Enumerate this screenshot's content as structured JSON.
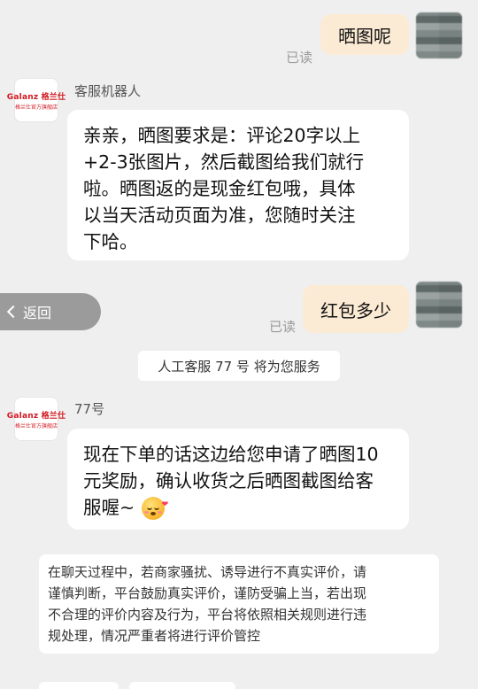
{
  "messages": {
    "user1": {
      "text": "晒图呢",
      "status": "已读"
    },
    "bot1": {
      "sender": "客服机器人",
      "lines": [
        "亲亲，晒图要求是：评论20字以上",
        "+2-3张图片，然后截图给我们就行",
        "啦。晒图返的是现金红包哦，具体",
        "以当天活动页面为准，您随时关注",
        "下哈。"
      ]
    },
    "user2": {
      "text": "红包多少",
      "status": "已读"
    },
    "system": {
      "text": "人工客服 77 号 将为您服务"
    },
    "agent": {
      "sender": "77号",
      "lines": [
        "现在下单的话这边给您申请了晒图10",
        "元奖励，确认收货之后晒图截图给客",
        "服喔~"
      ]
    }
  },
  "brand": {
    "top": "Galanz 格兰仕",
    "bottom": "格兰仕官方旗舰店"
  },
  "nav": {
    "back_label": "返回"
  },
  "notice": {
    "lines": [
      "在聊天过程中，若商家骚扰、诱导进行不真实评价，请",
      "谨慎判断，平台鼓励真实评价，谨防受骗上当，若出现",
      "不合理的评价内容及行为，平台将依照相关规则进行违",
      "规处理，情况严重者将进行评价管控"
    ]
  },
  "colors": {
    "user_bubble": "#fcebd4",
    "background": "#efefef",
    "brand_red": "#d2181f"
  },
  "icons": {
    "back": "chevron-left-icon",
    "emoji": "blushing-face-emoji"
  }
}
